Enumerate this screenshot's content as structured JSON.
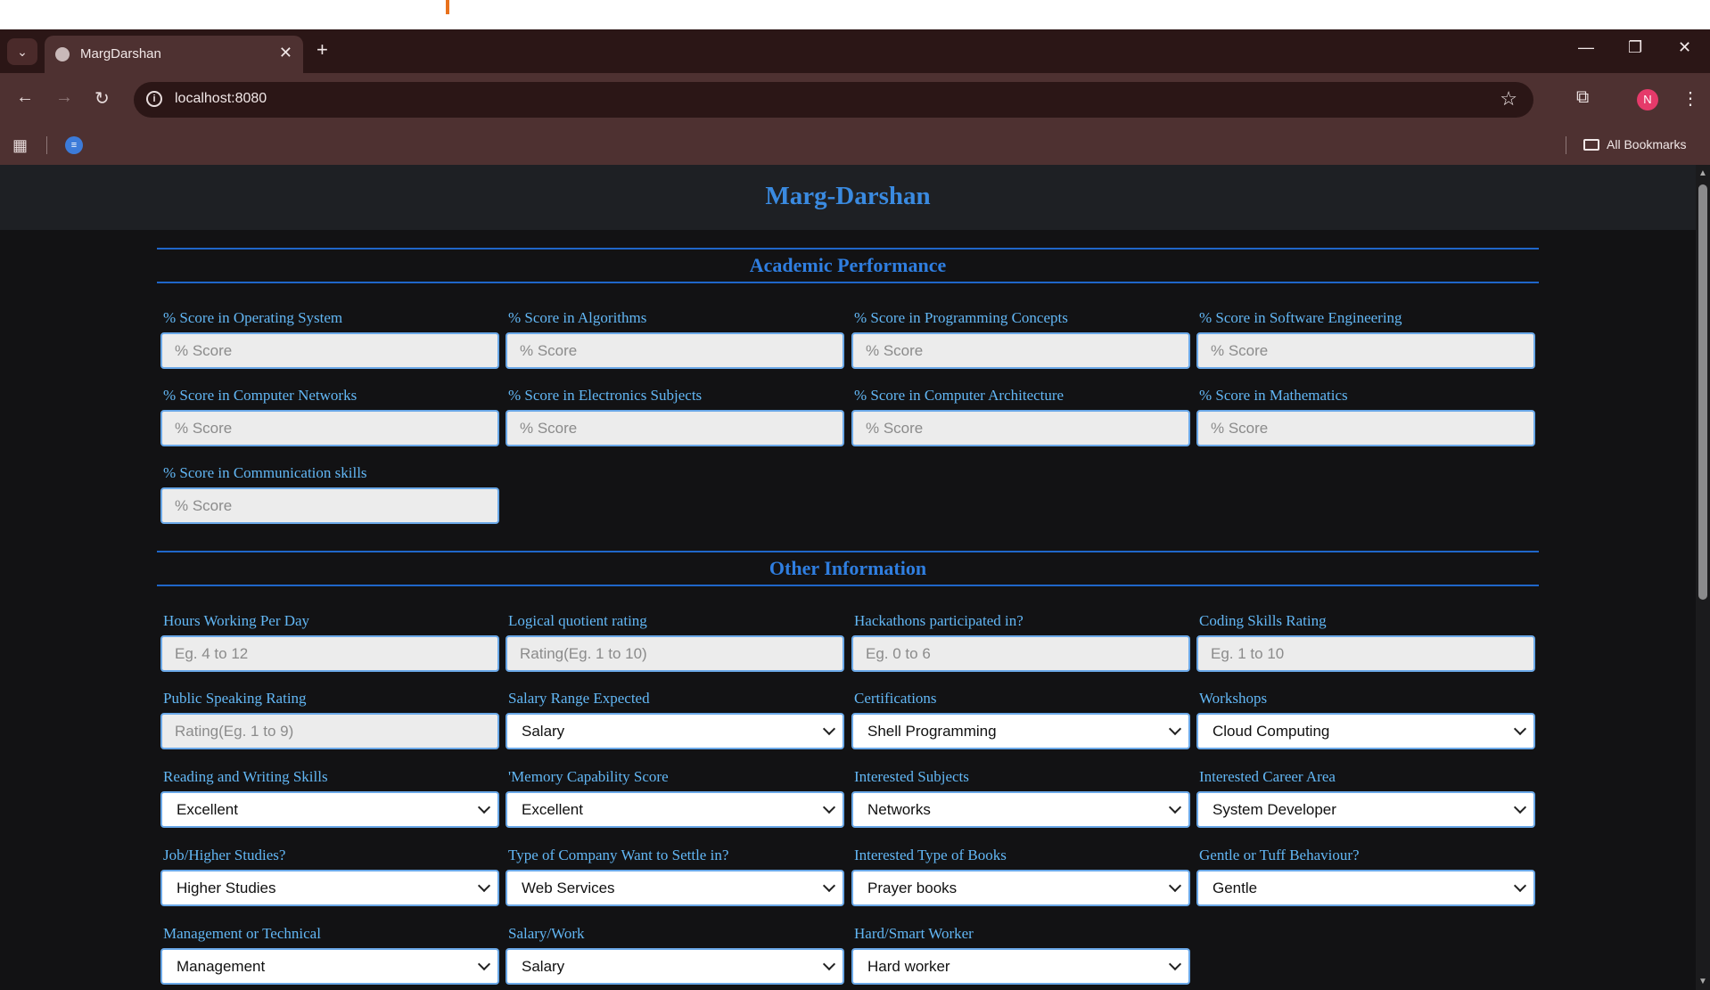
{
  "browser": {
    "tab_title": "MargDarshan",
    "url": "localhost:8080",
    "avatar_letter": "N",
    "all_bookmarks_label": "All Bookmarks"
  },
  "page": {
    "title": "Marg-Darshan",
    "academic": {
      "heading": "Academic Performance",
      "fields": [
        {
          "label": "% Score in Operating System",
          "placeholder": "% Score"
        },
        {
          "label": "% Score in Algorithms",
          "placeholder": "% Score"
        },
        {
          "label": "% Score in Programming Concepts",
          "placeholder": "% Score"
        },
        {
          "label": "% Score in Software Engineering",
          "placeholder": "% Score"
        },
        {
          "label": "% Score in Computer Networks",
          "placeholder": "% Score"
        },
        {
          "label": "% Score in Electronics Subjects",
          "placeholder": "% Score"
        },
        {
          "label": "% Score in Computer Architecture",
          "placeholder": "% Score"
        },
        {
          "label": "% Score in Mathematics",
          "placeholder": "% Score"
        },
        {
          "label": "% Score in Communication skills",
          "placeholder": "% Score"
        }
      ]
    },
    "other": {
      "heading": "Other Information",
      "inputs": [
        {
          "label": "Hours Working Per Day",
          "placeholder": "Eg. 4 to 12"
        },
        {
          "label": "Logical quotient rating",
          "placeholder": "Rating(Eg. 1 to 10)"
        },
        {
          "label": "Hackathons participated in?",
          "placeholder": "Eg. 0 to 6"
        },
        {
          "label": "Coding Skills Rating",
          "placeholder": "Eg. 1 to 10"
        },
        {
          "label": "Public Speaking Rating",
          "placeholder": "Rating(Eg. 1 to 9)"
        }
      ],
      "selects": [
        {
          "label": "Salary Range Expected",
          "value": "Salary"
        },
        {
          "label": "Certifications",
          "value": "Shell Programming"
        },
        {
          "label": "Workshops",
          "value": "Cloud Computing"
        },
        {
          "label": "Reading and Writing Skills",
          "value": "Excellent"
        },
        {
          "label": "'Memory Capability Score",
          "value": "Excellent"
        },
        {
          "label": "Interested Subjects",
          "value": "Networks"
        },
        {
          "label": "Interested Career Area",
          "value": "System Developer"
        },
        {
          "label": "Job/Higher Studies?",
          "value": "Higher Studies"
        },
        {
          "label": "Type of Company Want to Settle in?",
          "value": "Web Services"
        },
        {
          "label": "Interested Type of Books",
          "value": "Prayer books"
        },
        {
          "label": "Gentle or Tuff Behaviour?",
          "value": "Gentle"
        },
        {
          "label": "Management or Technical",
          "value": "Management"
        },
        {
          "label": "Salary/Work",
          "value": "Salary"
        },
        {
          "label": "Hard/Smart Worker",
          "value": "Hard worker"
        }
      ]
    }
  }
}
